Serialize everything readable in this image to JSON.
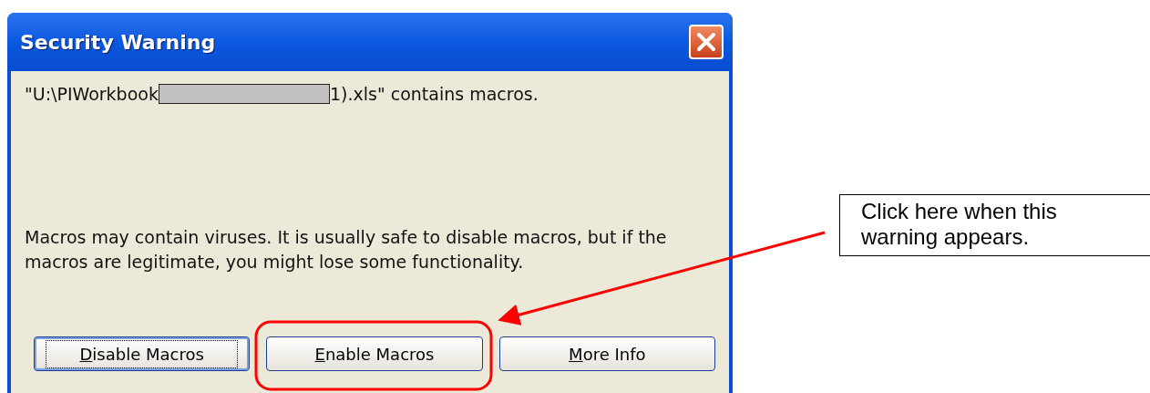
{
  "window": {
    "title": "Security Warning"
  },
  "file_message": {
    "before": "\"U:\\PIWorkbook",
    "redacted": true,
    "after": "1).xls\" contains macros."
  },
  "warning_text": "Macros may contain viruses. It is usually safe to disable macros, but if the macros are legitimate, you might lose some functionality.",
  "buttons": [
    {
      "label": "Disable Macros",
      "focused": true
    },
    {
      "label": "Enable Macros",
      "focused": false
    },
    {
      "label": "More Info",
      "focused": false
    }
  ],
  "callout": {
    "text": "Click here when this warning appears."
  }
}
